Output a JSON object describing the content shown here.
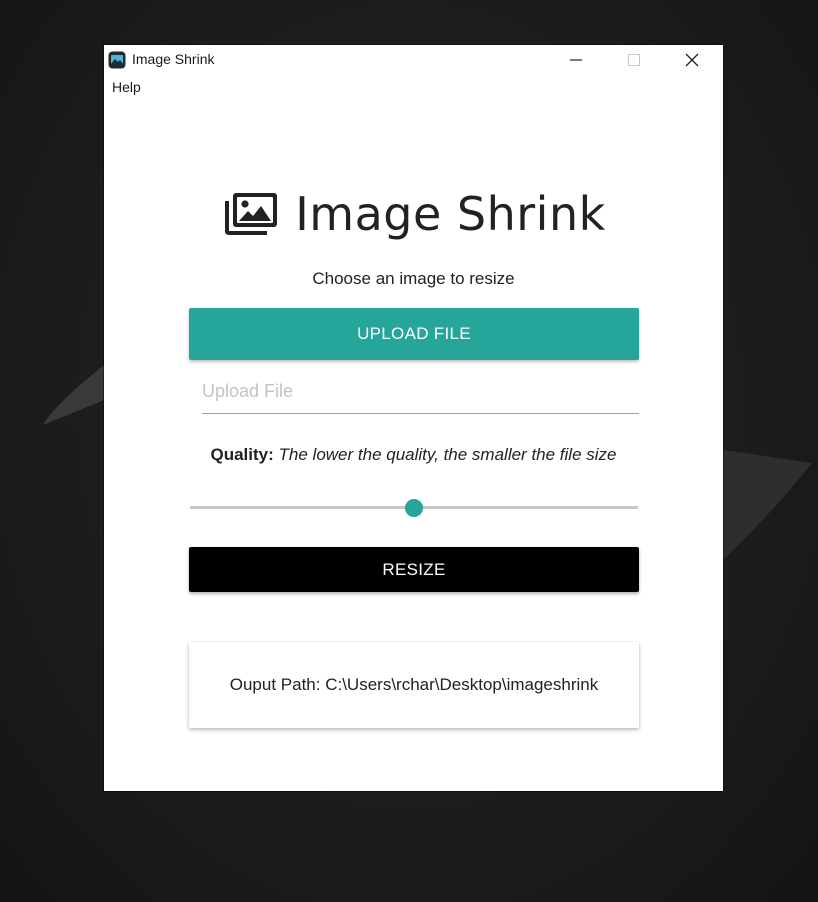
{
  "window": {
    "title": "Image Shrink",
    "controls": [
      "minimize",
      "maximize",
      "close"
    ]
  },
  "menubar": {
    "items": [
      {
        "label": "Help"
      }
    ]
  },
  "main": {
    "heading": "Image Shrink",
    "heading_icon": "images-icon",
    "subtitle": "Choose an image to resize",
    "upload_button": "UPLOAD FILE",
    "file_input": {
      "placeholder": "Upload File",
      "value": ""
    },
    "quality": {
      "label": "Quality:",
      "hint": "The lower the quality, the smaller the file size",
      "slider_value_percent": 50
    },
    "resize_button": "RESIZE",
    "output_path_text": "Ouput Path: C:\\Users\\rchar\\Desktop\\imageshrink"
  },
  "colors": {
    "accent": "#26a69a",
    "resize_button_bg": "#000000",
    "desktop_bg": "#1d1d1d"
  }
}
